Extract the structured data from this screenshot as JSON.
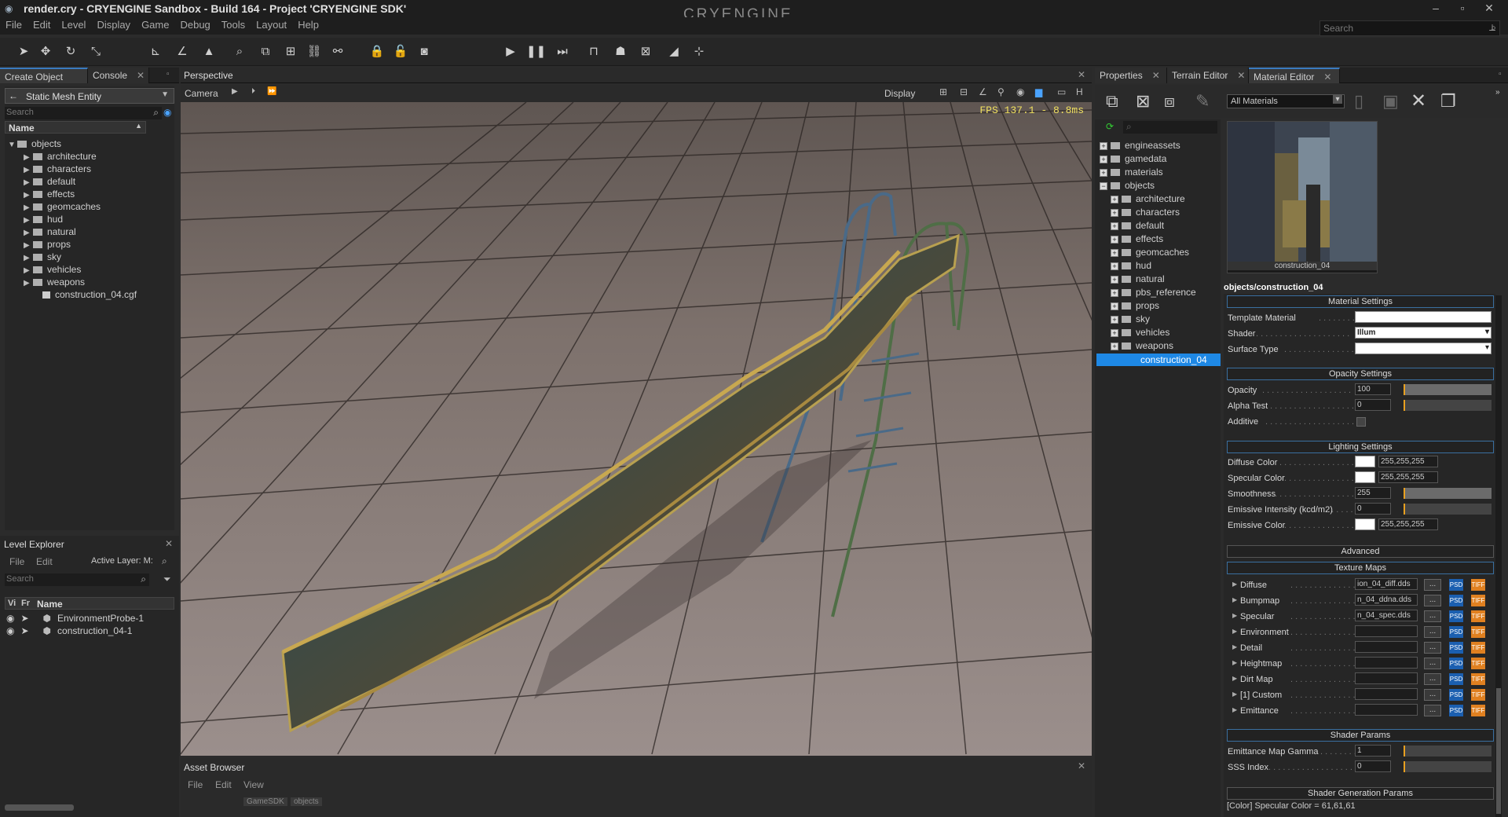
{
  "window": {
    "title": "render.cry - CRYENGINE Sandbox - Build 164 - Project 'CRYENGINE SDK'",
    "logo": "CRYENGINE",
    "search_placeholder": "Search"
  },
  "menu": [
    "File",
    "Edit",
    "Level",
    "Display",
    "Game",
    "Debug",
    "Tools",
    "Layout",
    "Help"
  ],
  "left_panel": {
    "tabs": [
      "Create Object",
      "Console"
    ],
    "entity_type": "Static Mesh Entity",
    "search_placeholder": "Search",
    "column": "Name",
    "tree_root": "objects",
    "tree_items": [
      "architecture",
      "characters",
      "default",
      "effects",
      "geomcaches",
      "hud",
      "natural",
      "props",
      "sky",
      "vehicles",
      "weapons"
    ],
    "file_item": "construction_04.cgf"
  },
  "level_explorer": {
    "title": "Level Explorer",
    "menu": [
      "File",
      "Edit"
    ],
    "active_layer": "Active Layer: M:",
    "search_placeholder": "Search",
    "columns": [
      "Vi",
      "Fr",
      "Name"
    ],
    "rows": [
      "EnvironmentProbe-1",
      "construction_04-1"
    ]
  },
  "viewport": {
    "tab": "Perspective",
    "camera_label": "Camera",
    "display_label": "Display",
    "fps": "FPS 137.1 - 8.8ms"
  },
  "asset_browser": {
    "title": "Asset Browser",
    "menu": [
      "File",
      "Edit",
      "View"
    ],
    "path": [
      "GameSDK",
      "objects"
    ]
  },
  "right_tabs": [
    "Properties",
    "Terrain Editor",
    "Material Editor"
  ],
  "material_editor": {
    "filter": "All Materials",
    "tree_top": [
      "engineassets",
      "gamedata",
      "materials",
      "objects"
    ],
    "tree_children": [
      "architecture",
      "characters",
      "default",
      "effects",
      "geomcaches",
      "hud",
      "natural",
      "pbs_reference",
      "props",
      "sky",
      "vehicles",
      "weapons"
    ],
    "selected": "construction_04",
    "preview_caption": "construction_04",
    "path": "objects/construction_04",
    "material_settings": {
      "header": "Material Settings",
      "template_label": "Template Material",
      "shader_label": "Shader",
      "shader_value": "Illum",
      "surface_label": "Surface Type"
    },
    "opacity_settings": {
      "header": "Opacity Settings",
      "opacity_label": "Opacity",
      "opacity_value": "100",
      "opacity_level": 1.0,
      "alpha_label": "Alpha Test",
      "alpha_value": "0",
      "additive_label": "Additive"
    },
    "lighting_settings": {
      "header": "Lighting Settings",
      "diffuse_label": "Diffuse Color",
      "diffuse_value": "255,255,255",
      "specular_label": "Specular Color",
      "specular_value": "255,255,255",
      "smoothness_label": "Smoothness",
      "smoothness_value": "255",
      "emissive_int_label": "Emissive Intensity (kcd/m2)",
      "emissive_int_value": "0",
      "emissive_color_label": "Emissive Color",
      "emissive_color_value": "255,255,255"
    },
    "advanced": "Advanced",
    "texture_maps": {
      "header": "Texture Maps",
      "rows": [
        {
          "label": "Diffuse",
          "value": "ion_04_diff.dds"
        },
        {
          "label": "Bumpmap",
          "value": "n_04_ddna.dds"
        },
        {
          "label": "Specular",
          "value": "n_04_spec.dds"
        },
        {
          "label": "Environment",
          "value": ""
        },
        {
          "label": "Detail",
          "value": ""
        },
        {
          "label": "Heightmap",
          "value": ""
        },
        {
          "label": "Dirt Map",
          "value": ""
        },
        {
          "label": "[1] Custom",
          "value": ""
        },
        {
          "label": "Emittance",
          "value": ""
        }
      ],
      "browse": "...",
      "psd": "PSD",
      "tiff": "TIFF"
    },
    "shader_params": {
      "header": "Shader Params",
      "gamma_label": "Emittance Map Gamma",
      "gamma_value": "1",
      "sss_label": "SSS Index",
      "sss_value": "0"
    },
    "shader_generation": "Shader Generation Params",
    "status": "[Color] Specular Color = 61,61,61"
  },
  "colors": {
    "accent": "#3a7bc0",
    "selection": "#1e88e5",
    "slider": "#e8a020"
  }
}
